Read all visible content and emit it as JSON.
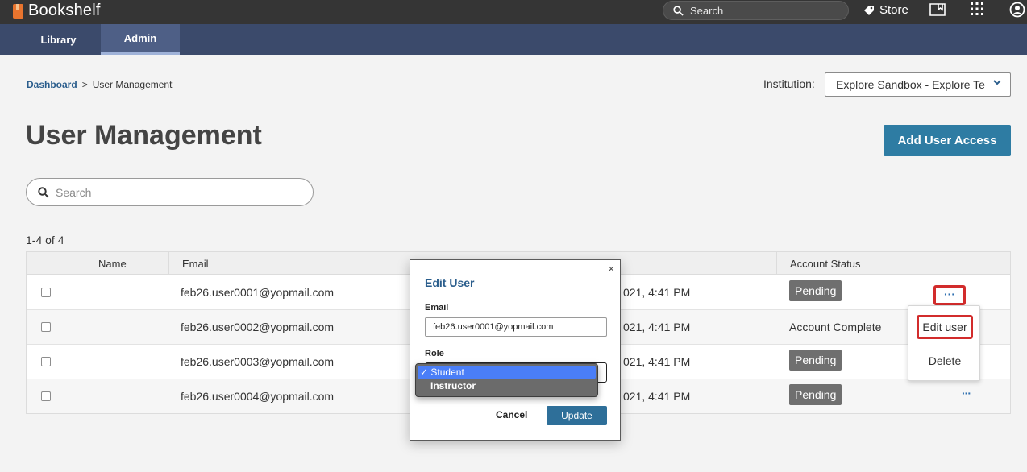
{
  "app": {
    "title": "Bookshelf"
  },
  "topbar": {
    "search_placeholder": "Search",
    "store_label": "Store"
  },
  "nav": {
    "tabs": [
      {
        "label": "Library",
        "active": false
      },
      {
        "label": "Admin",
        "active": true
      }
    ]
  },
  "breadcrumb": {
    "parent": "Dashboard",
    "separator": ">",
    "current": "User Management"
  },
  "institution": {
    "label": "Institution:",
    "selected": "Explore Sandbox - Explore Te"
  },
  "page": {
    "title": "User Management",
    "add_button": "Add User Access"
  },
  "list_search": {
    "placeholder": "Search"
  },
  "results": {
    "count": "1-4 of 4"
  },
  "table": {
    "headers": [
      "Name",
      "Email",
      "Account Status"
    ],
    "rows": [
      {
        "email": "feb26.user0001@yopmail.com",
        "date": "021, 4:41 PM",
        "status": "Pending",
        "status_type": "badge"
      },
      {
        "email": "feb26.user0002@yopmail.com",
        "date": "021, 4:41 PM",
        "status": "Account Complete",
        "status_type": "text"
      },
      {
        "email": "feb26.user0003@yopmail.com",
        "date": "021, 4:41 PM",
        "status": "Pending",
        "status_type": "badge"
      },
      {
        "email": "feb26.user0004@yopmail.com",
        "date": "021, 4:41 PM",
        "status": "Pending",
        "status_type": "badge"
      }
    ],
    "row_action": "···"
  },
  "row_menu": {
    "edit": "Edit user",
    "delete": "Delete"
  },
  "modal": {
    "title": "Edit User",
    "close": "×",
    "email_label": "Email",
    "email_value": "feb26.user0001@yopmail.com",
    "role_label": "Role",
    "role_options": [
      {
        "label": "Student",
        "selected": true,
        "check": "✓"
      },
      {
        "label": "Instructor",
        "selected": false
      }
    ],
    "cancel": "Cancel",
    "update": "Update"
  },
  "colors": {
    "topbar": "#353535",
    "navbar": "#3b4a6b",
    "accent": "#2e7ca3",
    "badge": "#6f6f6f",
    "highlight": "#d22c2c"
  }
}
